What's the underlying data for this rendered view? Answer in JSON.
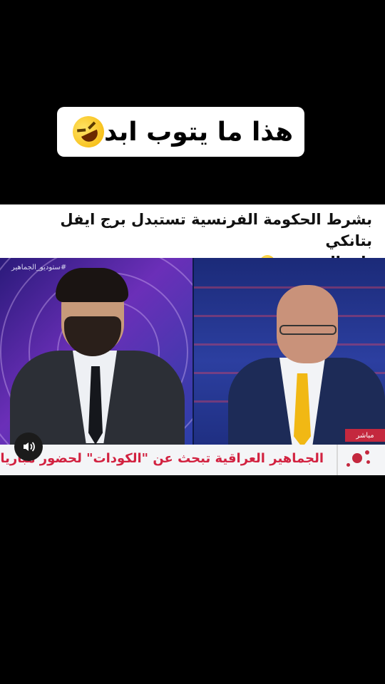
{
  "caption": {
    "text": "هذا ما يتوب ابد",
    "emoji": "rolling-on-floor-laughing-icon"
  },
  "post": {
    "line1": "بشرط  الحكومة الفرنسية تستبدل برج ايفل بتانكي",
    "line2": "باب الشرجي",
    "emoji": "tears-of-joy-icon"
  },
  "video": {
    "watermark": "#ستوديو_الجماهير",
    "live_label": "مباشر",
    "ticker_text": "الجماهير العراقية تبحث عن \"الكودات\" لحضور مباريات مونديال اميركا",
    "sound_icon": "speaker-icon"
  },
  "colors": {
    "accent": "#c4283e",
    "ticker_text": "#d22240",
    "background": "#000000"
  }
}
